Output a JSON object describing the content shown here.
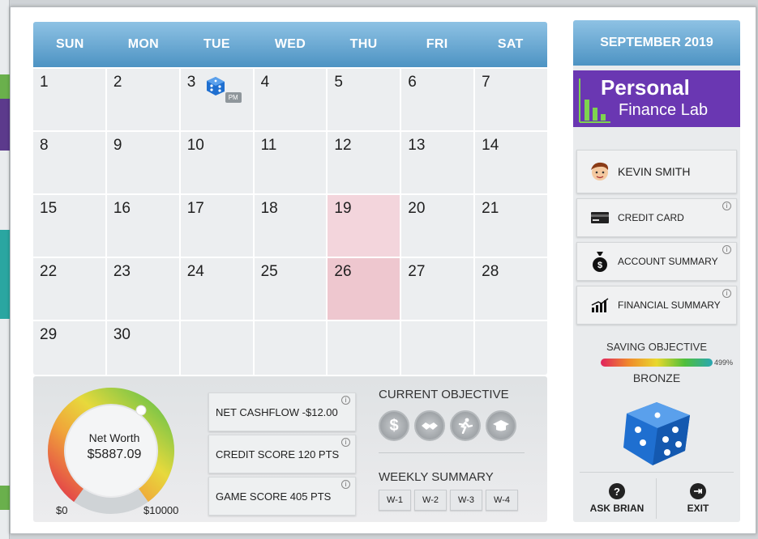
{
  "calendar": {
    "weekdays": [
      "SUN",
      "MON",
      "TUE",
      "WED",
      "THU",
      "FRI",
      "SAT"
    ],
    "days": [
      "1",
      "2",
      "3",
      "4",
      "5",
      "6",
      "7",
      "8",
      "9",
      "10",
      "11",
      "12",
      "13",
      "14",
      "15",
      "16",
      "17",
      "18",
      "19",
      "20",
      "21",
      "22",
      "23",
      "24",
      "25",
      "26",
      "27",
      "28",
      "29",
      "30"
    ],
    "event_tag": "PM"
  },
  "summary": {
    "net_worth_label": "Net Worth",
    "net_worth_value": "$5887.09",
    "gauge_min": "$0",
    "gauge_max": "$10000",
    "net_cashflow": "NET CASHFLOW  -$12.00",
    "credit_score": "CREDIT SCORE  120 PTS",
    "game_score": "GAME SCORE  405 PTS",
    "current_objective_title": "CURRENT OBJECTIVE",
    "weekly_summary_title": "WEEKLY SUMMARY",
    "weeks": [
      "W-1",
      "W-2",
      "W-3",
      "W-4"
    ]
  },
  "sidebar": {
    "month": "SEPTEMBER 2019",
    "logo_line1": "Personal",
    "logo_line2": "Finance Lab",
    "user_name": "KEVIN SMITH",
    "credit_card": "CREDIT CARD",
    "account_summary": "ACCOUNT SUMMARY",
    "financial_summary": "FINANCIAL SUMMARY",
    "saving_title": "SAVING OBJECTIVE",
    "saving_pct": "499%",
    "saving_level": "BRONZE",
    "ask_brian": "ASK BRIAN",
    "exit": "EXIT"
  },
  "info_glyph": "i",
  "colors": {
    "header_blue": "#4d93c3",
    "logo_purple": "#6a37b2",
    "highlight_pink": "#f3d5dc",
    "dice_blue": "#1f6fd0"
  }
}
